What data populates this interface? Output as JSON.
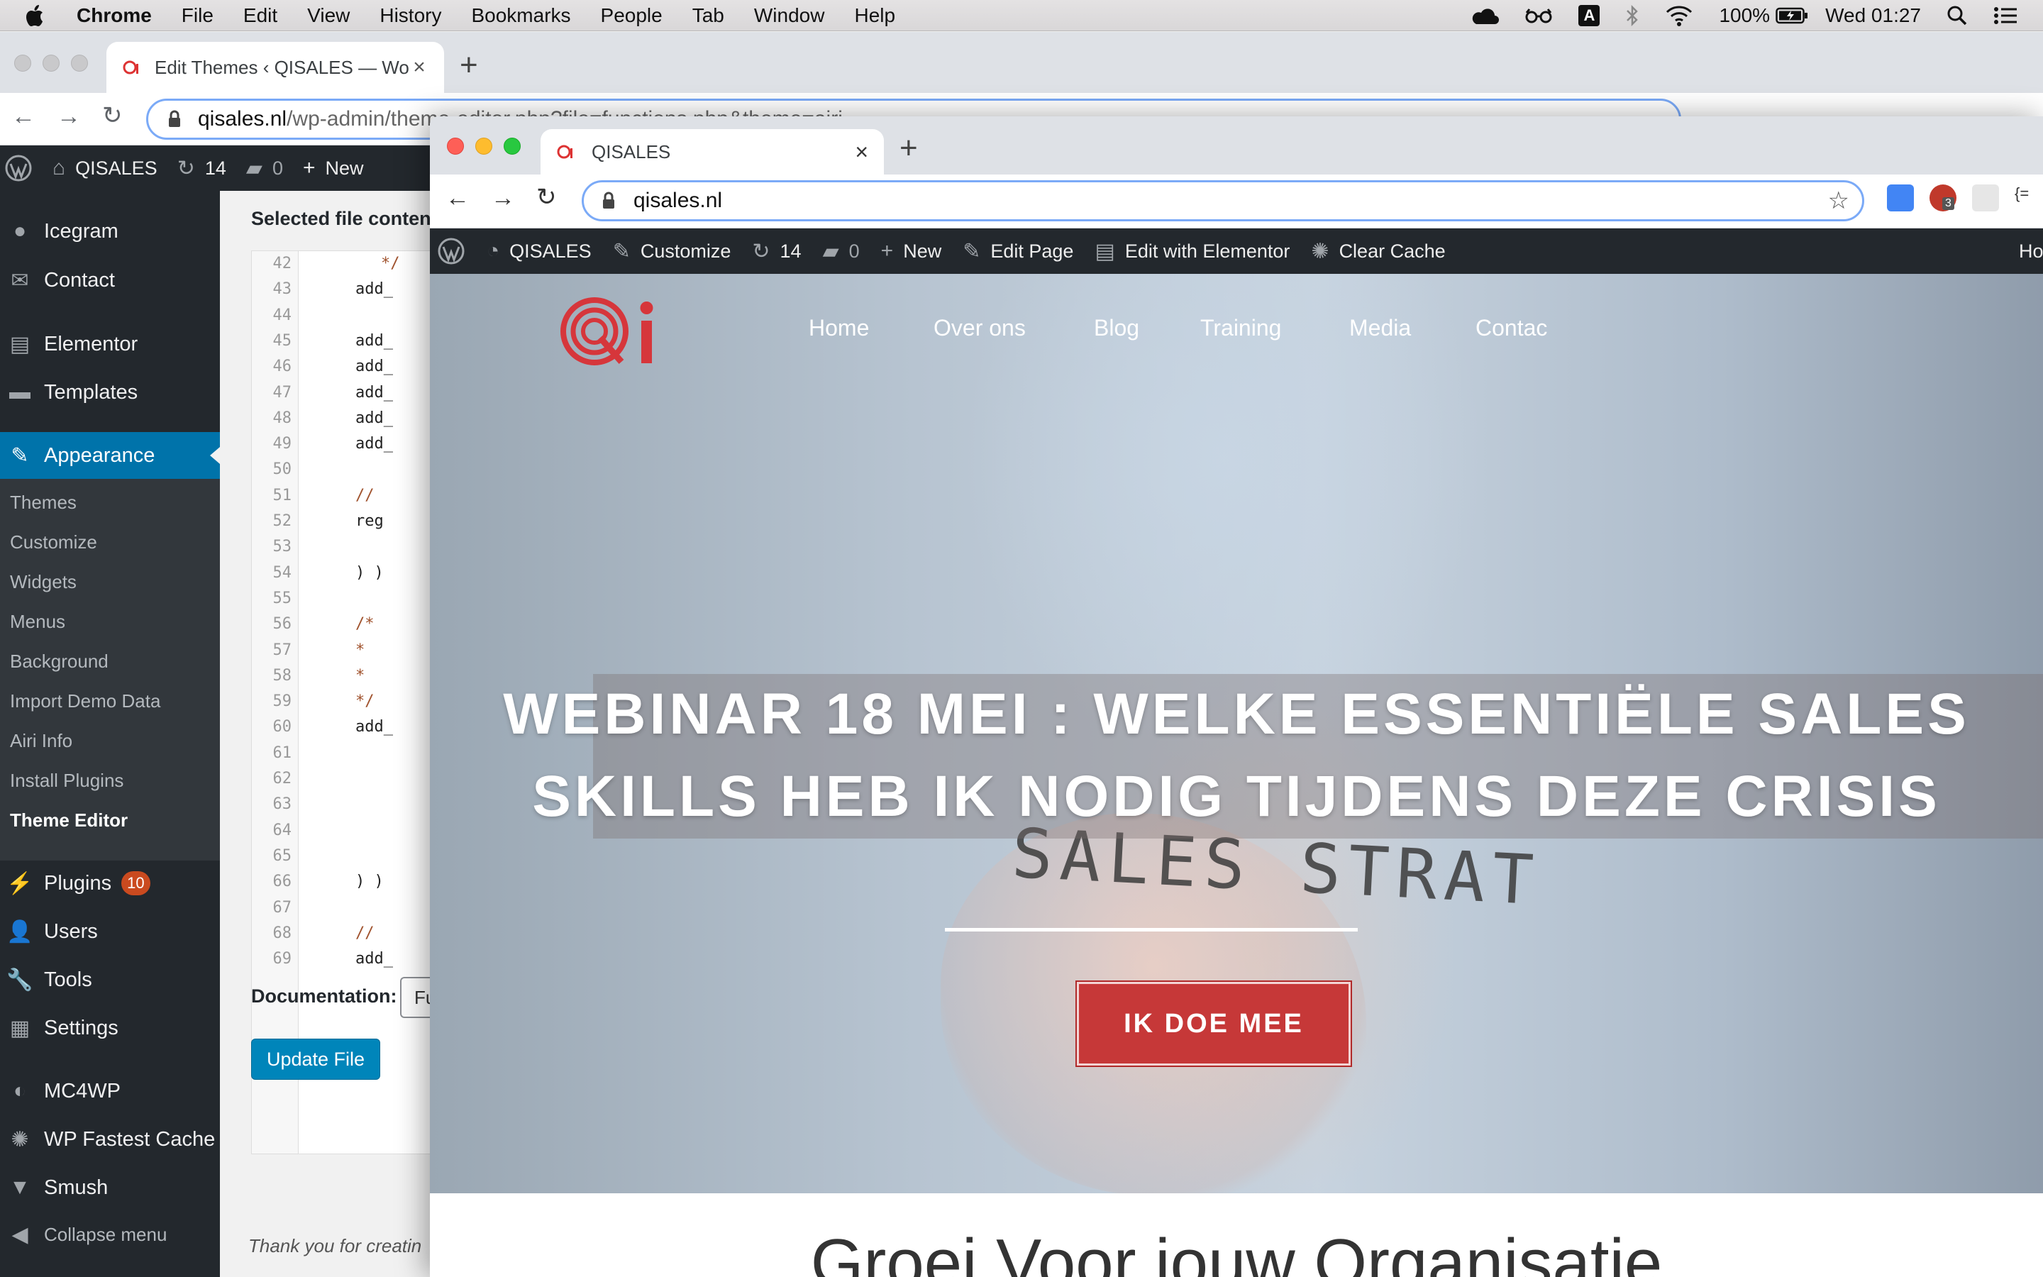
{
  "menubar": {
    "app": "Chrome",
    "menus": [
      "File",
      "Edit",
      "View",
      "History",
      "Bookmarks",
      "People",
      "Tab",
      "Window",
      "Help"
    ],
    "battery": "100%",
    "clock": "Wed 01:27",
    "input_source": "A"
  },
  "back_window": {
    "tab_title": "Edit Themes ‹ QISALES — Wor",
    "url_host": "qisales.nl",
    "url_path": "/wp-admin/theme-editor.php?file=functions.php&theme=airi"
  },
  "wp_adminbar": {
    "site": "QISALES",
    "updates": "14",
    "comments": "0",
    "new": "New"
  },
  "sidebar": {
    "top_items": [
      "Icegram",
      "Contact",
      "Elementor",
      "Templates"
    ],
    "active": "Appearance",
    "submenu": [
      "Themes",
      "Customize",
      "Widgets",
      "Menus",
      "Background",
      "Import Demo Data",
      "Airi Info",
      "Install Plugins",
      "Theme Editor"
    ],
    "bottom_items": [
      "Plugins",
      "Users",
      "Tools",
      "Settings",
      "MC4WP",
      "WP Fastest Cache",
      "Smush",
      "Collapse menu"
    ],
    "plugins_badge": "10"
  },
  "editor": {
    "selected_label": "Selected file conten",
    "lines": [
      {
        "n": "42",
        "t": "*/",
        "indent": 3,
        "comment": true
      },
      {
        "n": "43",
        "t": "add_",
        "indent": 2
      },
      {
        "n": "44",
        "t": ""
      },
      {
        "n": "45",
        "t": "add_",
        "indent": 2
      },
      {
        "n": "46",
        "t": "add_",
        "indent": 2
      },
      {
        "n": "47",
        "t": "add_",
        "indent": 2
      },
      {
        "n": "48",
        "t": "add_",
        "indent": 2
      },
      {
        "n": "49",
        "t": "add_",
        "indent": 2
      },
      {
        "n": "50",
        "t": ""
      },
      {
        "n": "51",
        "t": "// ",
        "indent": 2,
        "comment": true
      },
      {
        "n": "52",
        "t": "reg",
        "indent": 2
      },
      {
        "n": "53",
        "t": ""
      },
      {
        "n": "54",
        "t": ") )",
        "indent": 2
      },
      {
        "n": "55",
        "t": ""
      },
      {
        "n": "56",
        "t": "/*",
        "indent": 2,
        "comment": true
      },
      {
        "n": "57",
        "t": " * ",
        "indent": 2,
        "comment": true
      },
      {
        "n": "58",
        "t": " * ",
        "indent": 2,
        "comment": true
      },
      {
        "n": "59",
        "t": " */",
        "indent": 2,
        "comment": true
      },
      {
        "n": "60",
        "t": "add_",
        "indent": 2
      },
      {
        "n": "61",
        "t": ""
      },
      {
        "n": "62",
        "t": ""
      },
      {
        "n": "63",
        "t": ""
      },
      {
        "n": "64",
        "t": ""
      },
      {
        "n": "65",
        "t": ""
      },
      {
        "n": "66",
        "t": ") )",
        "indent": 2
      },
      {
        "n": "67",
        "t": ""
      },
      {
        "n": "68",
        "t": "// ",
        "indent": 2,
        "comment": true
      },
      {
        "n": "69",
        "t": "add_",
        "indent": 2
      }
    ],
    "documentation_label": "Documentation:",
    "documentation_value": "Fu",
    "update_button": "Update File",
    "footer": "Thank you for creatin"
  },
  "front_window": {
    "tab_title": "QISALES",
    "url": "qisales.nl",
    "ext_badge": "3",
    "adminbar": {
      "site": "QISALES",
      "customize": "Customize",
      "updates": "14",
      "comments": "0",
      "new": "New",
      "edit_page": "Edit Page",
      "elementor": "Edit with Elementor",
      "cache": "Clear Cache",
      "howdy": "How"
    }
  },
  "site": {
    "nav": [
      "Home",
      "Over ons",
      "Blog",
      "Training",
      "Media",
      "Contac"
    ],
    "headline_1": "WEBINAR 18 MEI : WELKE ESSENTIËLE SALES",
    "headline_2": "SKILLS HEB IK NODIG TIJDENS DEZE CRISIS",
    "hero_scribble": "SALES STRAT",
    "cta": "IK DOE MEE",
    "below_heading": "Groei Voor jouw Organisatie",
    "accent_color": "#c63838"
  }
}
